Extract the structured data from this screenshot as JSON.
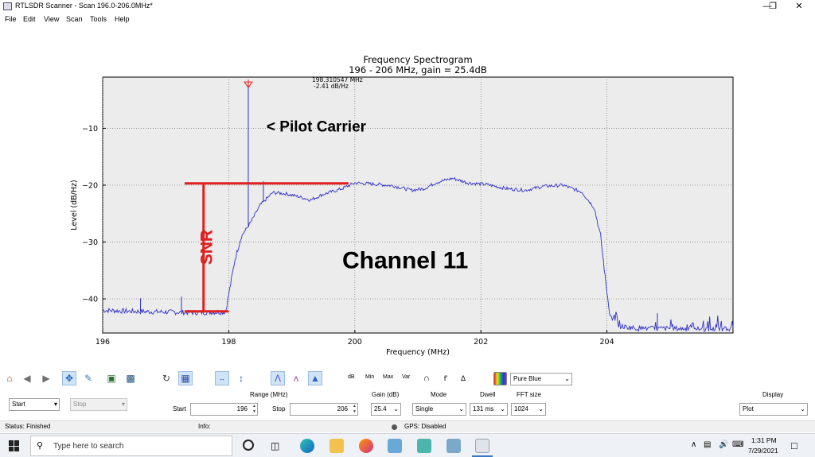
{
  "window": {
    "title": "RTLSDR Scanner - Scan 196.0-206.0MHz*",
    "minimize_icon": "minimize-icon",
    "restore_icon": "restore-icon",
    "close_icon": "close-icon"
  },
  "menu": {
    "items": [
      "File",
      "Edit",
      "View",
      "Scan",
      "Tools",
      "Help"
    ]
  },
  "plot": {
    "title": "Frequency Spectrogram",
    "subtitle": "196 - 206 MHz, gain = 25.4dB",
    "xlabel": "Frequency (MHz)",
    "ylabel": "Level (dB/Hz)",
    "peak_freq": "198.310547 MHz",
    "peak_level": "-2.41 dB/Hz",
    "annotation_pilot": "< Pilot Carrier",
    "annotation_channel": "Channel 11",
    "annotation_snr": "SNR",
    "line_color": "#3030c8",
    "marker_color": "#e02020"
  },
  "chart_data": {
    "type": "line",
    "title": "Frequency Spectrogram",
    "subtitle": "196 - 206 MHz, gain = 25.4dB",
    "xlabel": "Frequency (MHz)",
    "ylabel": "Level (dB/Hz)",
    "xlim": [
      196,
      206
    ],
    "ylim": [
      -46,
      -1
    ],
    "xticks": [
      196,
      198,
      200,
      202,
      204
    ],
    "yticks": [
      -10,
      -20,
      -30,
      -40
    ],
    "grid": true,
    "series": [
      {
        "values": [
          [
            196,
            -42.0
          ],
          [
            196.5,
            -42.2
          ],
          [
            197,
            -42.3
          ],
          [
            197.5,
            -42.4
          ],
          [
            197.95,
            -42.3
          ],
          [
            198.02,
            -38
          ],
          [
            198.1,
            -33
          ],
          [
            198.2,
            -29
          ],
          [
            198.35,
            -26.5
          ],
          [
            198.5,
            -23.5
          ],
          [
            198.7,
            -21.3
          ],
          [
            198.9,
            -21.5
          ],
          [
            199.1,
            -22.0
          ],
          [
            199.3,
            -22.6
          ],
          [
            199.5,
            -21.6
          ],
          [
            199.8,
            -20.6
          ],
          [
            200.0,
            -19.6
          ],
          [
            200.3,
            -19.8
          ],
          [
            200.6,
            -20.1
          ],
          [
            200.9,
            -20.9
          ],
          [
            201.1,
            -20.6
          ],
          [
            201.3,
            -19.5
          ],
          [
            201.55,
            -18.8
          ],
          [
            201.8,
            -19.6
          ],
          [
            202.1,
            -19.9
          ],
          [
            202.4,
            -20.6
          ],
          [
            202.7,
            -20.9
          ],
          [
            203.0,
            -20.2
          ],
          [
            203.3,
            -20.0
          ],
          [
            203.6,
            -21.2
          ],
          [
            203.8,
            -24.0
          ],
          [
            203.9,
            -29.0
          ],
          [
            203.98,
            -37.0
          ],
          [
            204.05,
            -43.0
          ],
          [
            204.2,
            -44.8
          ],
          [
            204.5,
            -45.2
          ],
          [
            205,
            -45.2
          ],
          [
            205.5,
            -45.3
          ],
          [
            206,
            -45.3
          ]
        ],
        "spikes": [
          [
            196.6,
            -39.9
          ],
          [
            197.25,
            -39.6
          ],
          [
            198.31,
            -2.41
          ],
          [
            198.55,
            -19.3
          ],
          [
            204.8,
            -42.5
          ]
        ]
      }
    ],
    "peak": {
      "x": 198.310547,
      "y": -2.41
    },
    "snr_marker": {
      "x": 197.6,
      "top": -19.7,
      "bottom": -42.2,
      "x_start": 197.3,
      "x_top_end": 199.9,
      "x_bottom_end": 198.0
    }
  },
  "toolbar": {
    "icons": [
      "home-icon",
      "back-icon",
      "forward-icon",
      "pan-icon",
      "edit-icon",
      "subplots-icon",
      "save-icon",
      "refresh-icon",
      "grid-icon",
      "autoscale-x-icon",
      "autoscale-y-icon",
      "peak-icon",
      "peaks-icon",
      "fill-icon",
      "db-icon",
      "delta-icon"
    ],
    "labels": [
      "Min",
      "Max",
      "Var"
    ],
    "colormap_label": "Pure Blue"
  },
  "controls": {
    "start_button": "Start",
    "stop_button": "Stop",
    "range_label": "Range (MHz)",
    "start_label": "Start",
    "stop_label": "Stop",
    "start_value": "196",
    "stop_value": "206",
    "gain_label": "Gain (dB)",
    "gain_value": "25.4",
    "mode_label": "Mode",
    "mode_value": "Single",
    "dwell_label": "Dwell",
    "dwell_value": "131 ms",
    "fft_label": "FFT size",
    "fft_value": "1024",
    "display_label": "Display",
    "display_value": "Plot"
  },
  "status": {
    "status_text": "Status: Finished",
    "info_text": "Info:",
    "gps_text": "GPS: Disabled"
  },
  "taskbar": {
    "search_placeholder": "Type here to search",
    "time": "1:31 PM",
    "date": "7/29/2021"
  }
}
